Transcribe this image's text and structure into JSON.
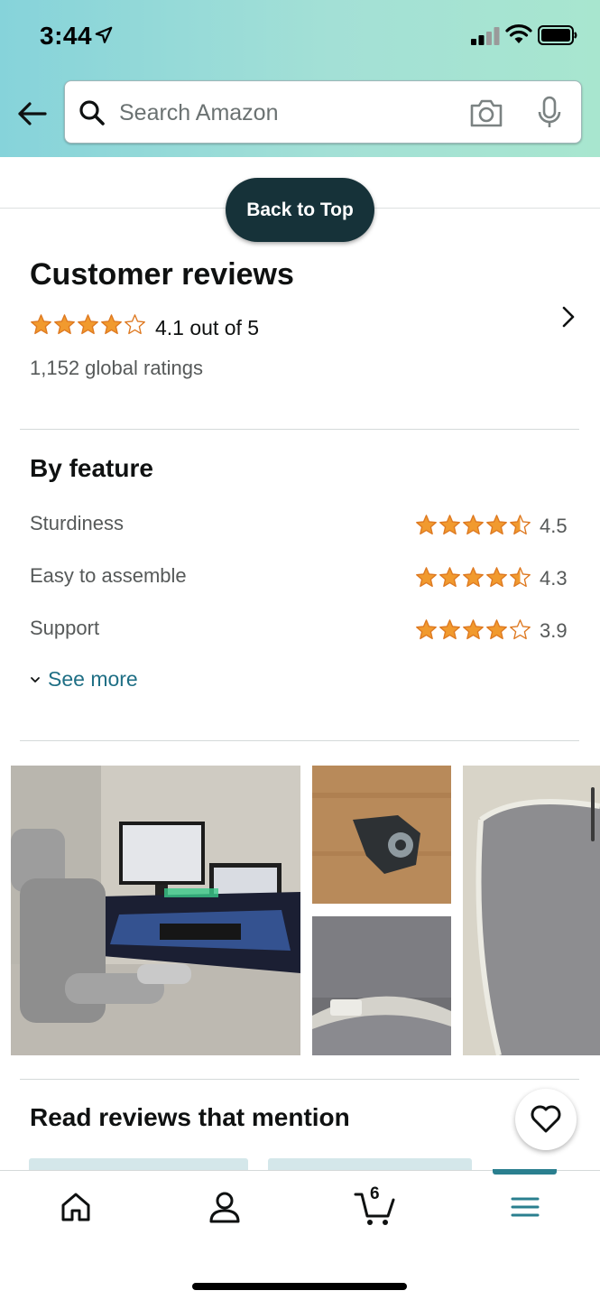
{
  "status_bar": {
    "time": "3:44"
  },
  "search": {
    "placeholder": "Search Amazon"
  },
  "back_to_top_label": "Back to Top",
  "reviews": {
    "title": "Customer reviews",
    "rating_text": "4.1 out of 5",
    "rating_value": 4.1,
    "global_ratings": "1,152 global ratings"
  },
  "by_feature": {
    "title": "By feature",
    "items": [
      {
        "name": "Sturdiness",
        "score": "4.5",
        "value": 4.5
      },
      {
        "name": "Easy to assemble",
        "score": "4.3",
        "value": 4.3
      },
      {
        "name": "Support",
        "score": "3.9",
        "value": 3.9
      }
    ],
    "see_more": "See more"
  },
  "photos": [
    {
      "desc_icon": "desk-setup-photo"
    },
    {
      "desc_icon": "bracket-part-photo"
    },
    {
      "desc_icon": "mesh-headrest-photo"
    },
    {
      "desc_icon": "mesh-seat-photo"
    }
  ],
  "mentions": {
    "title": "Read reviews that mention"
  },
  "bottom_nav": {
    "items": [
      "home-icon",
      "account-icon",
      "cart-icon",
      "menu-icon"
    ],
    "cart_count": "6",
    "active": "menu-icon"
  },
  "colors": {
    "star": "#f19a2e",
    "link": "#1f6f85",
    "back_to_top_bg": "#163239",
    "accent": "#2a7f8f"
  }
}
